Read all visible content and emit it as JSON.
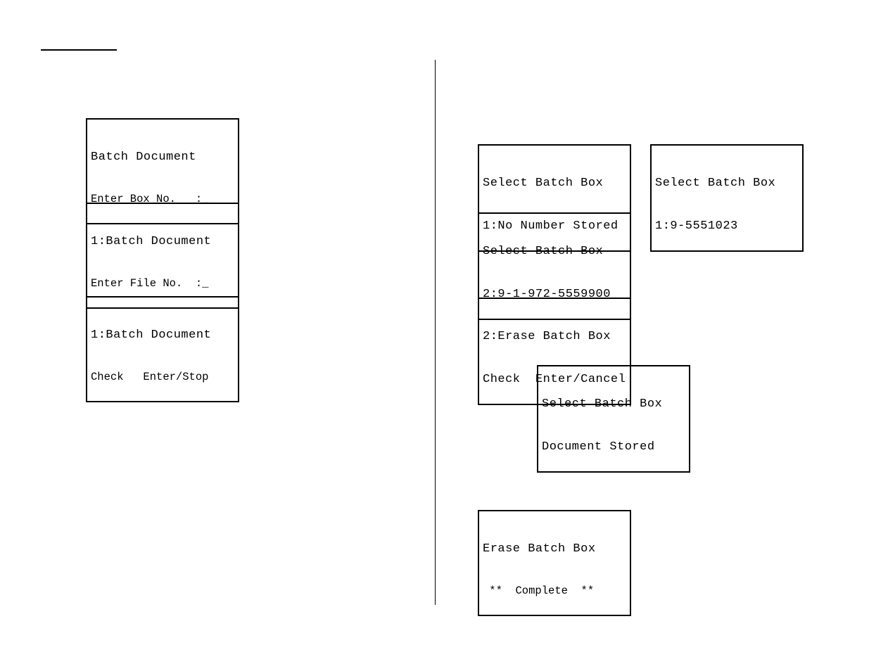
{
  "left": {
    "box1": {
      "line1": "Batch Document",
      "line2": "Enter Box No.   :_"
    },
    "box2": {
      "line1": "1:Batch Document",
      "line2": "Enter File No.  :_"
    },
    "box3": {
      "line1": "1:Batch Document",
      "line2": "Check   Enter/Stop"
    }
  },
  "right": {
    "box1a": {
      "line1": "Select Batch Box",
      "line2": "1:No Number Stored"
    },
    "box1b": {
      "line1": "Select Batch Box",
      "line2": "1:9-5551023"
    },
    "box2": {
      "line1": "Select Batch Box",
      "line2": "2:9-1-972-5559900"
    },
    "box3": {
      "line1": "2:Erase Batch Box",
      "line2": "Check  Enter/Cancel"
    },
    "box4": {
      "line1": "Select Batch Box",
      "line2": "Document Stored"
    },
    "box5": {
      "line1": "Erase Batch Box",
      "line2": " **  Complete  **"
    }
  }
}
